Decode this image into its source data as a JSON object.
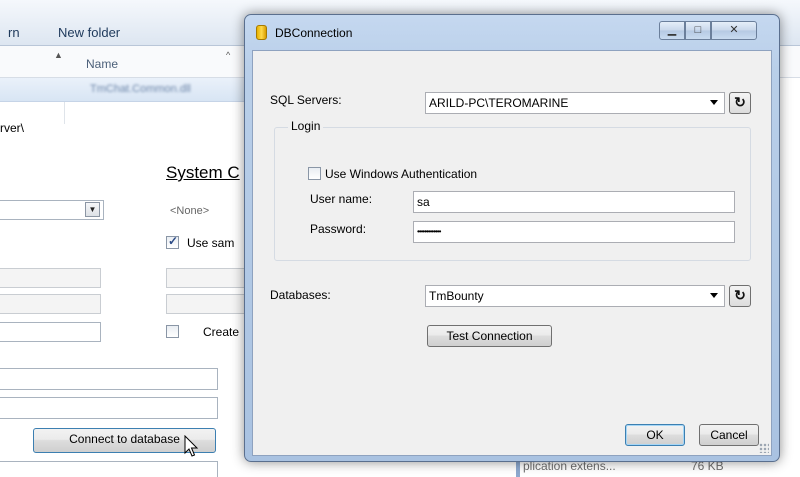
{
  "background": {
    "toolbar": {
      "left_fragment": "rn",
      "new_folder": "New folder"
    },
    "columns": {
      "name_header": "Name",
      "blurred_row": "TmChat.Common.dll"
    },
    "path_fragment": "rver\\",
    "system_heading": "System C",
    "none_option": "<None>",
    "use_same_label": "Use sam",
    "create_label": "Create",
    "connect_button": "Connect to database",
    "file_type": "plication extens...",
    "file_size": "76 KB"
  },
  "dialog": {
    "title": "DBConnection",
    "sql_servers_label": "SQL Servers:",
    "sql_server_value": "ARILD-PC\\TEROMARINE",
    "login_group_title": "Login",
    "windows_auth_label": "Use Windows Authentication",
    "windows_auth_checked": false,
    "username_label": "User name:",
    "username_value": "sa",
    "password_label": "Password:",
    "password_value": "•••••••••••••",
    "databases_label": "Databases:",
    "database_value": "TmBounty",
    "test_connection_label": "Test Connection",
    "ok_label": "OK",
    "cancel_label": "Cancel"
  }
}
